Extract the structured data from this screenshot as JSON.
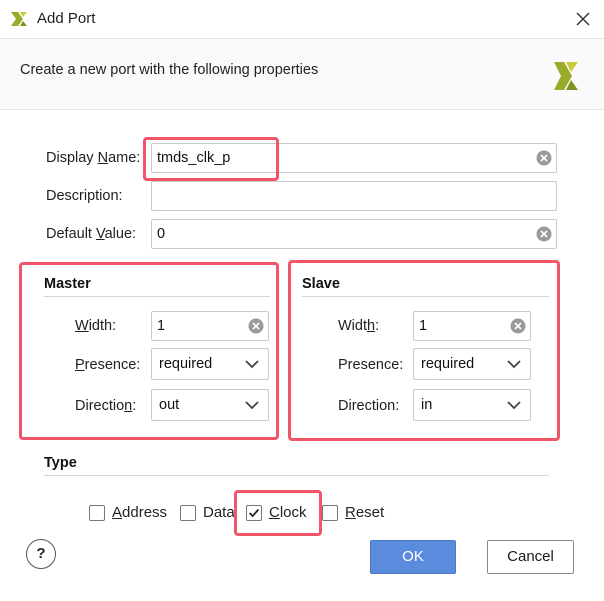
{
  "window": {
    "title": "Add Port",
    "close_glyph": "✕"
  },
  "header": {
    "text": "Create a new port with the following properties"
  },
  "form": {
    "display_name": {
      "label_pre": "Display ",
      "label_mn": "N",
      "label_post": "ame:",
      "value": "tmds_clk_p"
    },
    "description": {
      "label": "Description:",
      "value": ""
    },
    "default_value": {
      "label_pre": "Default ",
      "label_mn": "V",
      "label_post": "alue:",
      "value": "0"
    }
  },
  "master": {
    "title": "Master",
    "width": {
      "label_mn": "W",
      "label_post": "idth:",
      "value": "1"
    },
    "presence": {
      "label_mn": "P",
      "label_post": "resence:",
      "value": "required"
    },
    "direction": {
      "label_pre": "Directio",
      "label_mn": "n",
      "label_post": ":",
      "value": "out"
    }
  },
  "slave": {
    "title": "Slave",
    "width": {
      "label_pre": "Widt",
      "label_mn": "h",
      "label_post": ":",
      "value": "1"
    },
    "presence": {
      "label_pre": "Presence:",
      "value": "required"
    },
    "direction": {
      "label_pre": "Direction:",
      "value": "in"
    }
  },
  "type": {
    "title": "Type",
    "address": {
      "label_mn": "A",
      "label_post": "ddress",
      "checked": false
    },
    "data": {
      "label": "Data",
      "checked": false
    },
    "clock": {
      "label_mn": "C",
      "label_post": "lock",
      "checked": true
    },
    "reset": {
      "label_mn": "R",
      "label_post": "eset",
      "checked": false
    }
  },
  "buttons": {
    "help": "?",
    "ok": "OK",
    "cancel": "Cancel"
  },
  "colors": {
    "highlight": "#f0556a",
    "ok_bg": "#5b8bdc",
    "logo_green": "#9aab2a"
  }
}
